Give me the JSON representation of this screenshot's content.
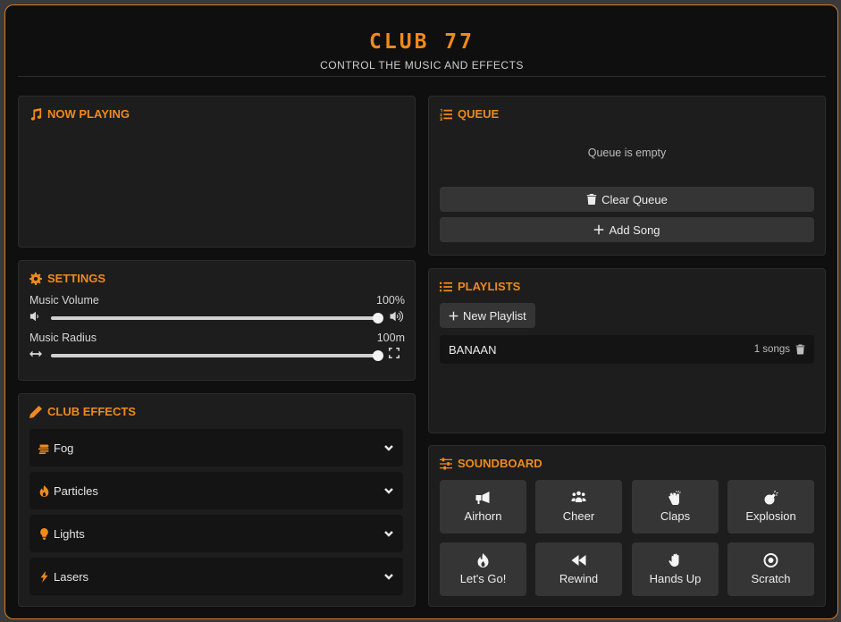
{
  "header": {
    "title": "CLUB 77",
    "subtitle": "CONTROL THE MUSIC AND EFFECTS"
  },
  "now_playing": {
    "title": "NOW PLAYING",
    "icon": "music-note-icon"
  },
  "settings": {
    "title": "SETTINGS",
    "icon": "gear-icon",
    "volume": {
      "label": "Music Volume",
      "value_text": "100%",
      "level": 1.0
    },
    "radius": {
      "label": "Music Radius",
      "value_text": "100m",
      "level": 1.0
    }
  },
  "club_effects": {
    "title": "CLUB EFFECTS",
    "icon": "pencil-icon",
    "items": [
      {
        "label": "Fog",
        "icon": "fog-icon"
      },
      {
        "label": "Particles",
        "icon": "flame-icon"
      },
      {
        "label": "Lights",
        "icon": "bulb-icon"
      },
      {
        "label": "Lasers",
        "icon": "bolt-icon"
      }
    ]
  },
  "queue": {
    "title": "QUEUE",
    "icon": "numbered-list-icon",
    "empty_text": "Queue is empty",
    "clear_label": "Clear Queue",
    "add_label": "Add Song"
  },
  "playlists": {
    "title": "PLAYLISTS",
    "icon": "list-icon",
    "new_label": "New Playlist",
    "items": [
      {
        "name": "BANAAN",
        "count": "1 songs"
      }
    ]
  },
  "soundboard": {
    "title": "SOUNDBOARD",
    "icon": "sliders-icon",
    "buttons": [
      {
        "label": "Airhorn",
        "icon": "megaphone-icon"
      },
      {
        "label": "Cheer",
        "icon": "crowd-icon"
      },
      {
        "label": "Claps",
        "icon": "clap-icon"
      },
      {
        "label": "Explosion",
        "icon": "bomb-icon"
      },
      {
        "label": "Let's Go!",
        "icon": "fire-icon"
      },
      {
        "label": "Rewind",
        "icon": "rewind-icon"
      },
      {
        "label": "Hands Up",
        "icon": "hand-icon"
      },
      {
        "label": "Scratch",
        "icon": "record-icon"
      }
    ]
  },
  "colors": {
    "accent": "#f08a1c",
    "border": "#d87a2c"
  }
}
